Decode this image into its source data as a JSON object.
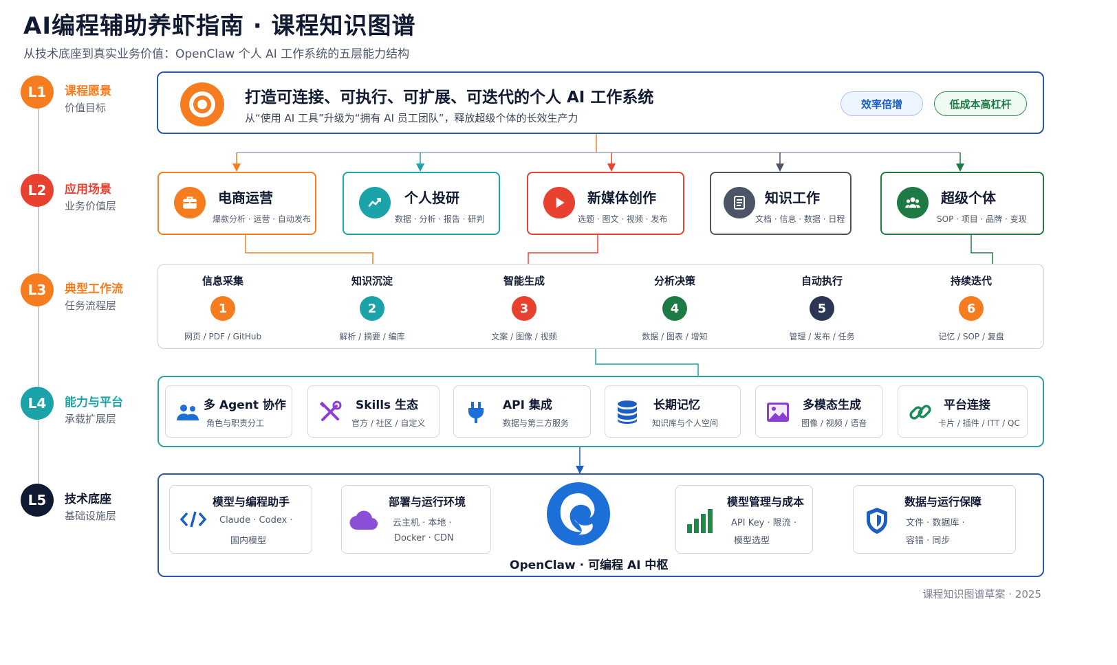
{
  "header": {
    "title": "AI编程辅助养虾指南 · 课程知识图谱",
    "subtitle": "从技术底座到真实业务价值：OpenClaw 个人 AI 工作系统的五层能力结构"
  },
  "levels": [
    {
      "badge": "L1",
      "name": "课程愿景",
      "desc": "价值目标",
      "color": "#f57c1f"
    },
    {
      "badge": "L2",
      "name": "应用场景",
      "desc": "业务价值层",
      "color": "#e8412f"
    },
    {
      "badge": "L3",
      "name": "典型工作流",
      "desc": "任务流程层",
      "color": "#f57c1f"
    },
    {
      "badge": "L4",
      "name": "能力与平台",
      "desc": "承载扩展层",
      "color": "#1aa3a8"
    },
    {
      "badge": "L5",
      "name": "技术底座",
      "desc": "基础设施层",
      "color": "#111a33"
    }
  ],
  "vision": {
    "headline": "打造可连接、可执行、可扩展、可迭代的个人 AI 工作系统",
    "sub": "从“使用 AI 工具”升级为“拥有 AI 员工团队”，释放超级个体的长效生产力",
    "icon": "target-icon",
    "pills": [
      {
        "label": "效率倍增",
        "color": "#1b5fc2"
      },
      {
        "label": "低成本高杠杆",
        "color": "#1d7a45"
      }
    ]
  },
  "scenarios": [
    {
      "title": "电商运营",
      "tags": "爆款分析 · 运营 · 自动发布",
      "icon": "briefcase-icon",
      "color": "#f57c1f"
    },
    {
      "title": "个人投研",
      "tags": "数据 · 分析 · 报告 · 研判",
      "icon": "trend-chart-icon",
      "color": "#1aa3a8"
    },
    {
      "title": "新媒体创作",
      "tags": "选题 · 图文 · 视频 · 发布",
      "icon": "play-icon",
      "color": "#e8412f"
    },
    {
      "title": "知识工作",
      "tags": "文档 · 信息 · 数据 · 日程",
      "icon": "document-icon",
      "color": "#4b5566"
    },
    {
      "title": "超级个体",
      "tags": "SOP · 项目 · 品牌 · 变现",
      "icon": "group-icon",
      "color": "#1d7a45"
    }
  ],
  "workflow": [
    {
      "title": "信息采集",
      "num": "1",
      "tags": "网页 / PDF / GitHub",
      "color": "#f57c1f"
    },
    {
      "title": "知识沉淀",
      "num": "2",
      "tags": "解析 / 摘要 / 编库",
      "color": "#1aa3a8"
    },
    {
      "title": "智能生成",
      "num": "3",
      "tags": "文案 / 图像 / 视频",
      "color": "#e8412f"
    },
    {
      "title": "分析决策",
      "num": "4",
      "tags": "数据 / 图表 / 增知",
      "color": "#1d7a45"
    },
    {
      "title": "自动执行",
      "num": "5",
      "tags": "管理 / 发布 / 任务",
      "color": "#2a3654"
    },
    {
      "title": "持续迭代",
      "num": "6",
      "tags": "记忆 / SOP / 复盘",
      "color": "#f57c1f"
    }
  ],
  "capabilities": [
    {
      "title": "多 Agent 协作",
      "desc": "角色与职责分工",
      "icon": "team-icon",
      "color": "#1b6fd6"
    },
    {
      "title": "Skills 生态",
      "desc": "官方 / 社区 / 自定义",
      "icon": "tools-icon",
      "color": "#8a3fd1"
    },
    {
      "title": "API 集成",
      "desc": "数据与第三方服务",
      "icon": "plug-icon",
      "color": "#1b6fd6"
    },
    {
      "title": "长期记忆",
      "desc": "知识库与个人空间",
      "icon": "database-icon",
      "color": "#1b5fc2"
    },
    {
      "title": "多模态生成",
      "desc": "图像 / 视频 / 语音",
      "icon": "image-icon",
      "color": "#8a3fd1"
    },
    {
      "title": "平台连接",
      "desc": "卡片 / 插件 / ITT / QC",
      "icon": "link-icon",
      "color": "#1d8a5a"
    }
  ],
  "tech": [
    {
      "title": "模型与编程助手",
      "line1": "Claude · Codex ·",
      "line2": "国内模型",
      "icon": "code-icon",
      "color": "#1b5fc2"
    },
    {
      "title": "部署与运行环境",
      "line1": "云主机 · 本地 ·",
      "line2": "Docker · CDN",
      "icon": "cloud-icon",
      "color": "#8a4fd6"
    },
    {
      "title": "模型管理与成本",
      "line1": "API Key · 限流 ·",
      "line2": "模型选型",
      "icon": "bar-chart-icon",
      "color": "#1d8a45"
    },
    {
      "title": "数据与运行保障",
      "line1": "文件 · 数据库 ·",
      "line2": "容错 · 同步",
      "icon": "shield-icon",
      "color": "#1b5fc2"
    }
  ],
  "hub": {
    "label": "OpenClaw · 可编程 AI 中枢",
    "icon": "openclaw-logo-icon",
    "color": "#1b6fd6"
  },
  "footer": "课程知识图谱草案 · 2025"
}
